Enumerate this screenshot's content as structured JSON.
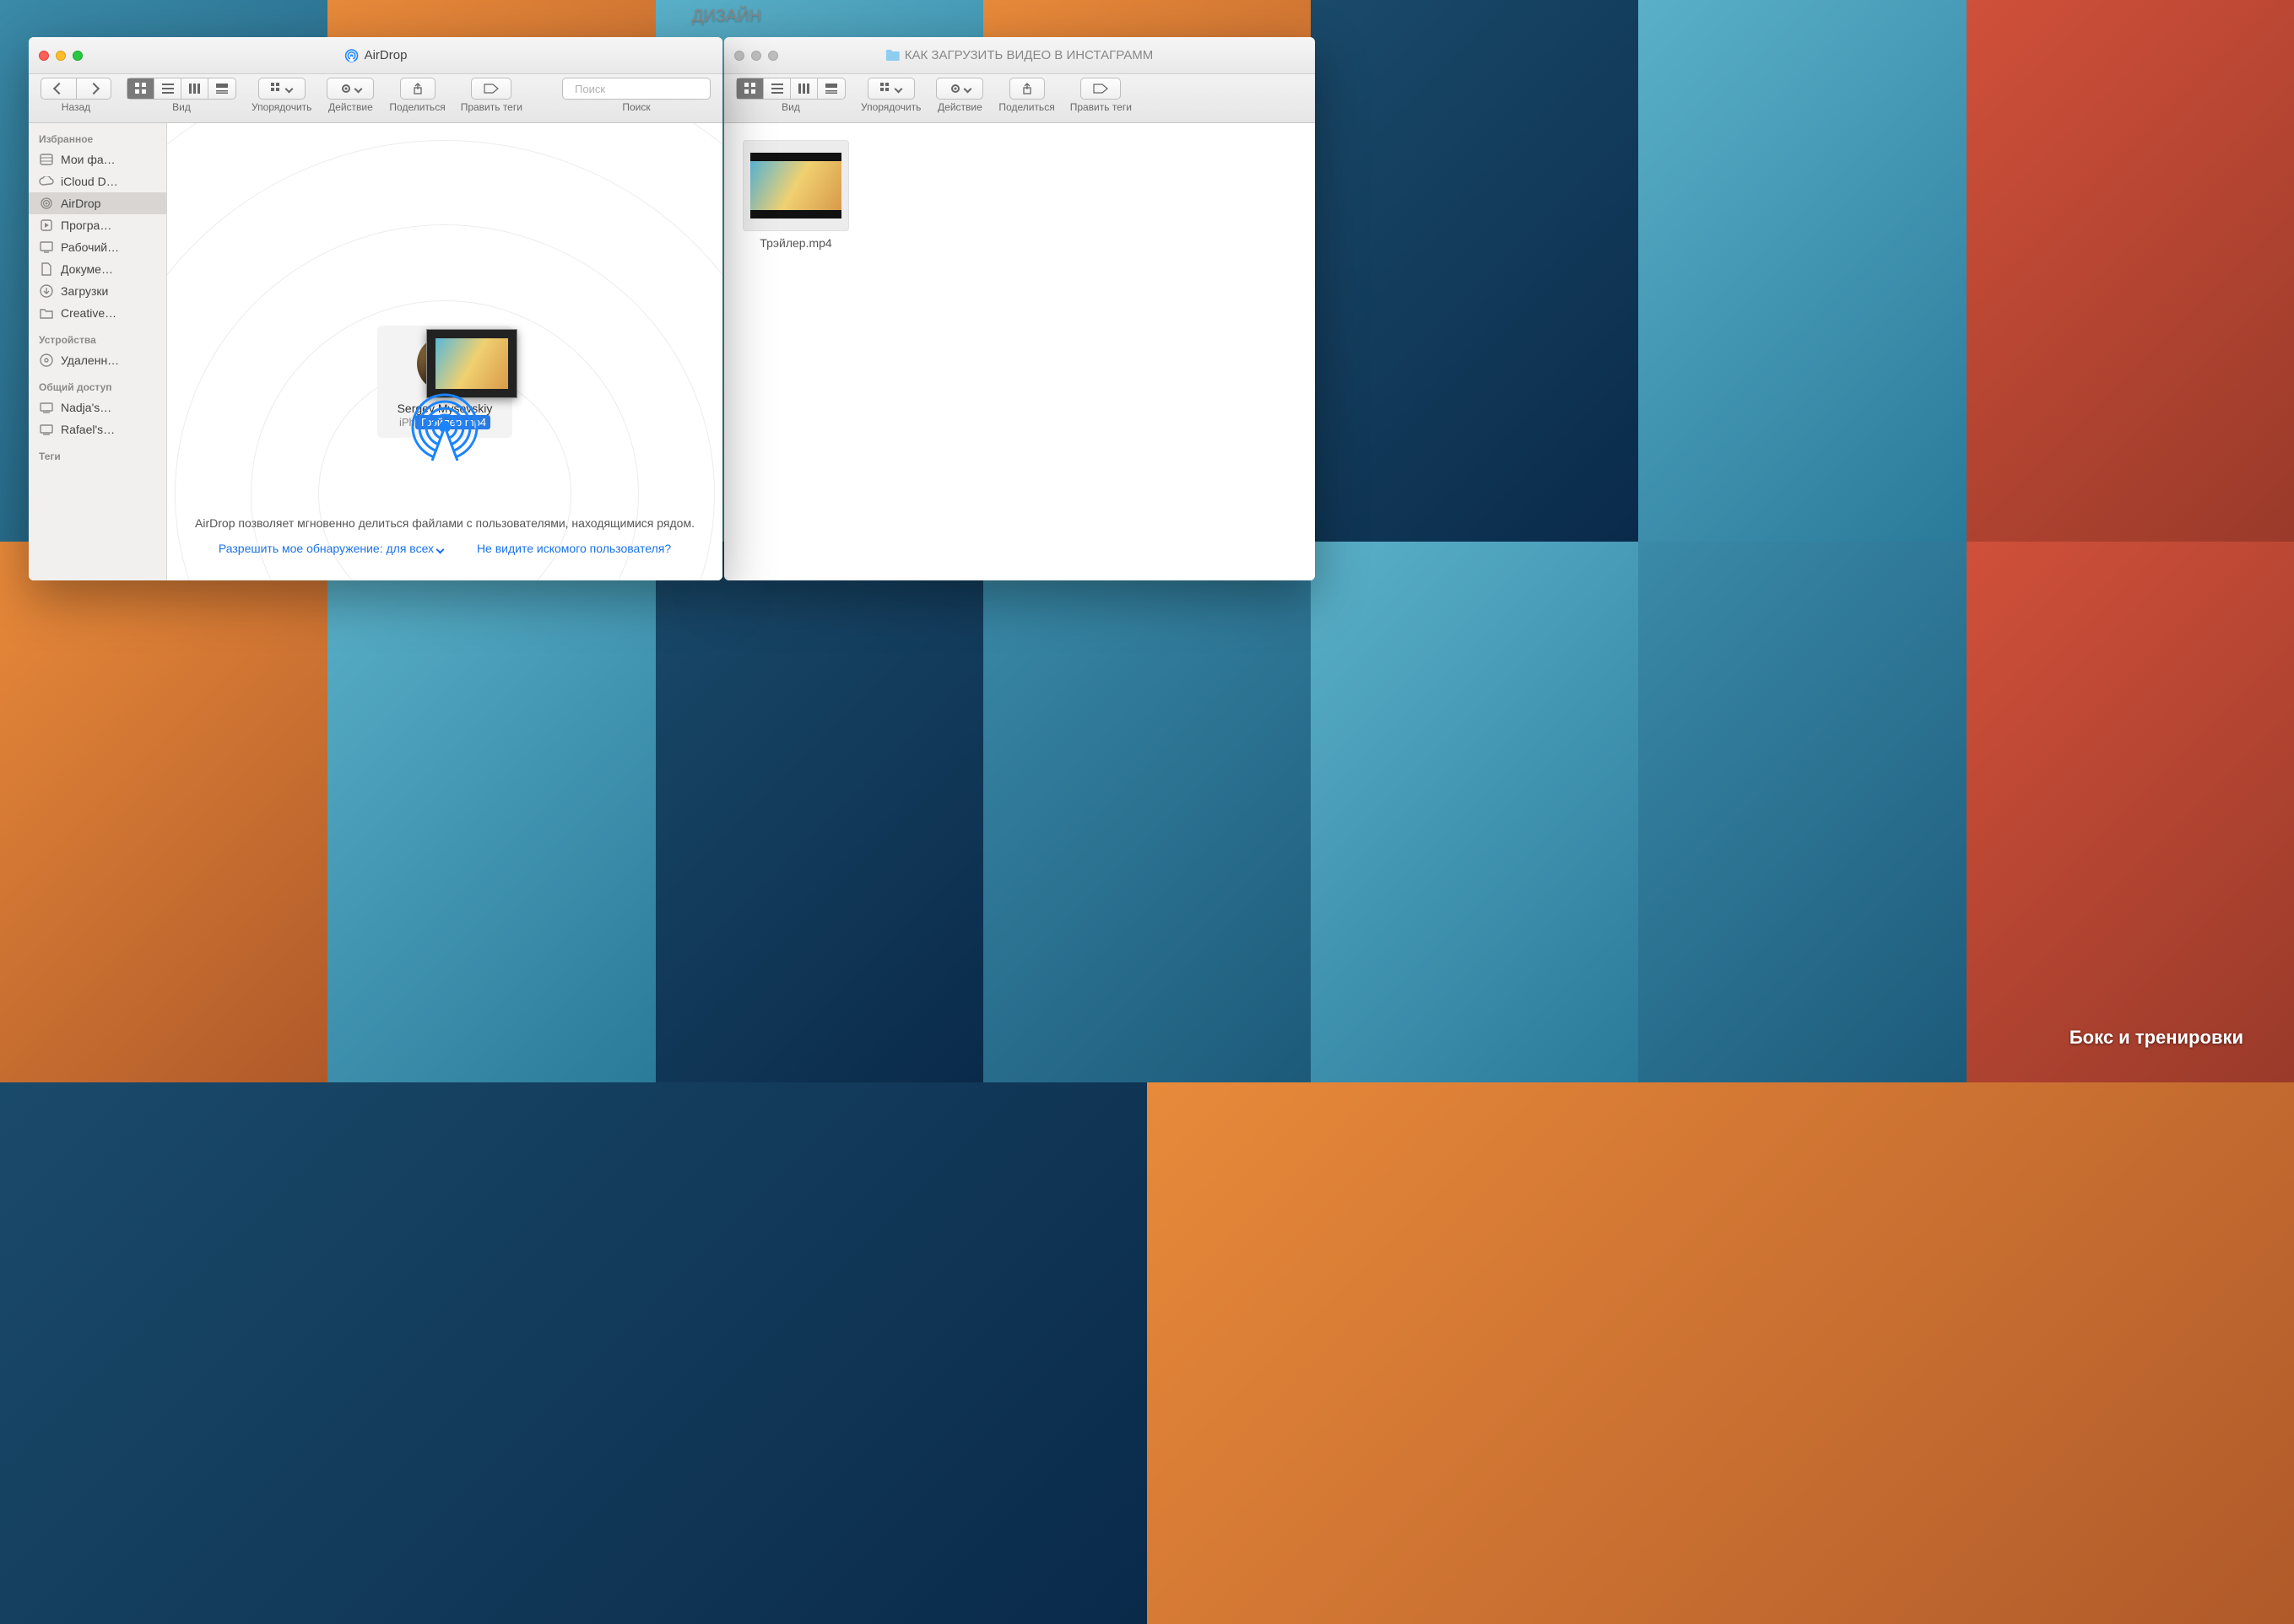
{
  "desktop": {
    "label_top": "ДИЗАЙН",
    "label_bottom": "Бокс и\nтренировки"
  },
  "finder_front": {
    "title": "AirDrop",
    "toolbar": {
      "back_label": "Назад",
      "view_label": "Вид",
      "arrange_label": "Упорядочить",
      "action_label": "Действие",
      "share_label": "Поделиться",
      "tags_label": "Править теги",
      "search_placeholder": "Поиск",
      "search_label": "Поиск"
    },
    "sidebar": {
      "sections": [
        {
          "header": "Избранное",
          "items": [
            {
              "icon": "all-files-icon",
              "label": "Мои фа…"
            },
            {
              "icon": "cloud-icon",
              "label": "iCloud D…"
            },
            {
              "icon": "airdrop-icon",
              "label": "AirDrop",
              "active": true
            },
            {
              "icon": "applications-icon",
              "label": "Програ…"
            },
            {
              "icon": "desktop-icon",
              "label": "Рабочий…"
            },
            {
              "icon": "documents-icon",
              "label": "Докуме…"
            },
            {
              "icon": "downloads-icon",
              "label": "Загрузки"
            },
            {
              "icon": "folder-icon",
              "label": "Creative…"
            }
          ]
        },
        {
          "header": "Устройства",
          "items": [
            {
              "icon": "disc-icon",
              "label": "Удаленн…"
            }
          ]
        },
        {
          "header": "Общий доступ",
          "items": [
            {
              "icon": "computer-icon",
              "label": "Nadja's…"
            },
            {
              "icon": "computer-icon",
              "label": "Rafael's…"
            }
          ]
        },
        {
          "header": "Теги",
          "items": []
        }
      ]
    },
    "airdrop": {
      "target_name": "Sergey Mysovskiy",
      "target_device_prefix": "iPh",
      "dragged_file": "Трэйлер.mp4",
      "info_text": "AirDrop позволяет мгновенно делиться файлами с пользователями, находящимися рядом.",
      "discover_link": "Разрешить мое обнаружение: для всех",
      "help_link": "Не видите искомого пользователя?"
    }
  },
  "finder_back": {
    "title": "КАК ЗАГРУЗИТЬ ВИДЕО В ИНСТАГРАММ",
    "toolbar": {
      "view_label": "Вид",
      "arrange_label": "Упорядочить",
      "action_label": "Действие",
      "share_label": "Поделиться",
      "tags_label": "Править теги"
    },
    "files": [
      {
        "name": "Трэйлер.mp4"
      }
    ]
  }
}
